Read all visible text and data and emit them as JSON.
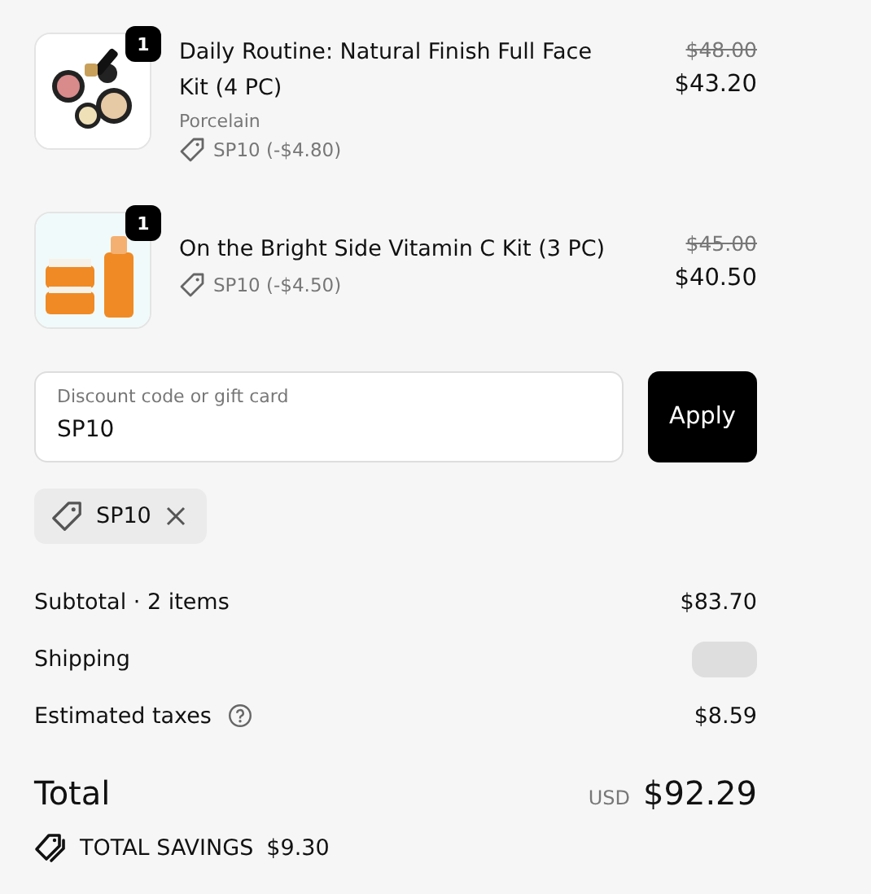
{
  "items": [
    {
      "quantity": "1",
      "title": "Daily Routine: Natural Finish Full Face Kit (4 PC)",
      "variant": "Porcelain",
      "discount": "SP10 (-$4.80)",
      "original_price": "$48.00",
      "price": "$43.20",
      "kind": "makeup"
    },
    {
      "quantity": "1",
      "title": "On the Bright Side Vitamin C Kit (3 PC)",
      "discount": "SP10 (-$4.50)",
      "original_price": "$45.00",
      "price": "$40.50",
      "kind": "skincare"
    }
  ],
  "discount_field": {
    "label": "Discount code or gift card",
    "value": "SP10"
  },
  "apply_button": "Apply",
  "applied_code": "SP10",
  "summary": [
    {
      "label": "Subtotal · 2 items",
      "value": "$83.70",
      "kind": "text"
    },
    {
      "label": "Shipping",
      "kind": "loading"
    },
    {
      "label": "Estimated taxes",
      "value": "$8.59",
      "kind": "help"
    }
  ],
  "total": {
    "label": "Total",
    "currency": "USD",
    "value": "$92.29"
  },
  "savings": {
    "label": "TOTAL SAVINGS",
    "value": "$9.30"
  }
}
